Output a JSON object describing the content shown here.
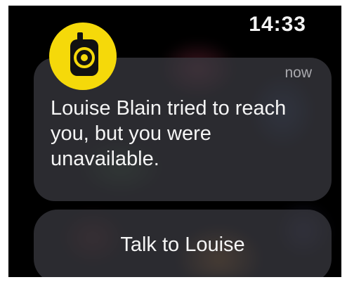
{
  "status_bar": {
    "time": "14:33"
  },
  "app": {
    "icon": "walkie-talkie-icon",
    "icon_color": "#f5d90a"
  },
  "notification": {
    "timestamp": "now",
    "message": "Louise Blain tried to reach you, but you were unavailable."
  },
  "action": {
    "label": "Talk to Louise"
  }
}
